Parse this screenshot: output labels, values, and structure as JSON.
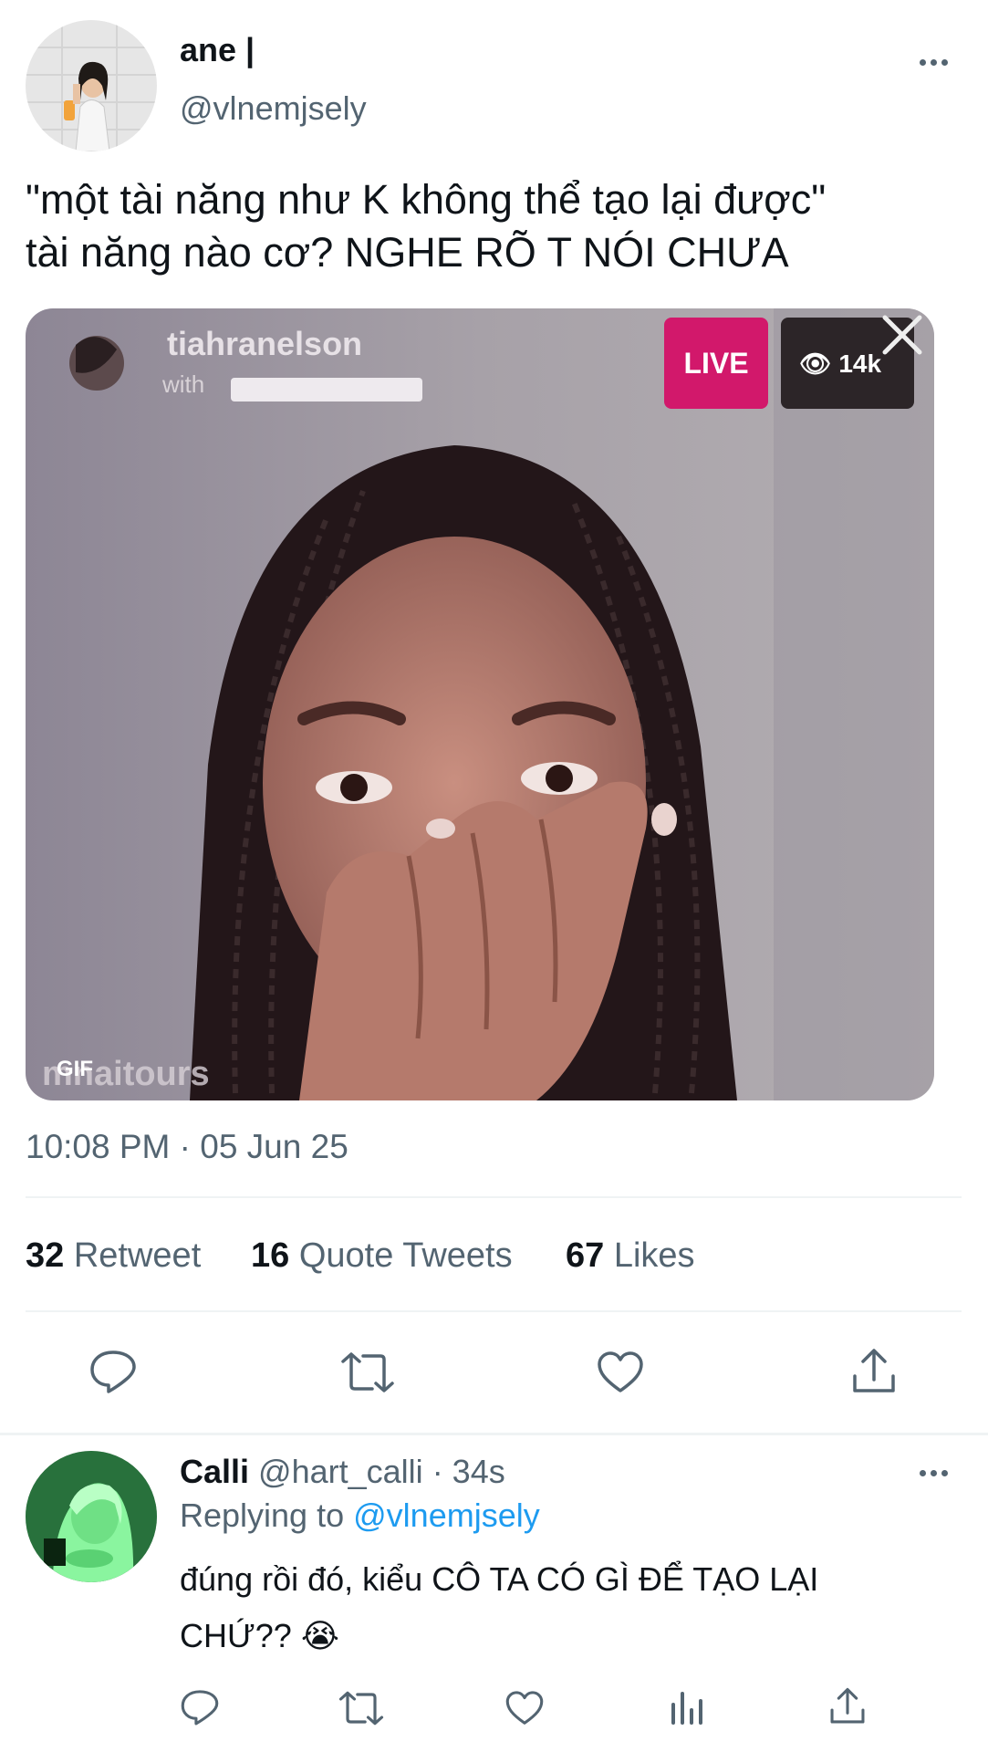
{
  "tweet": {
    "author_name": "ane |",
    "author_handle": "@vlnemjsely",
    "text_line1": "\"một tài năng như K không thể tạo lại được\"",
    "text_line2": "tài năng nào cơ? NGHE RÕ T NÓI CHƯA",
    "media": {
      "overlay_username": "tiahranelson",
      "overlay_with": "with",
      "live_label": "LIVE",
      "viewer_count": "14k",
      "gif_badge": "GIF",
      "watermark": "mnaitours"
    },
    "timestamp": "10:08 PM · 05 Jun 25",
    "stats": {
      "retweets_count": "32",
      "retweets_label": "Retweet",
      "quotes_count": "16",
      "quotes_label": "Quote Tweets",
      "likes_count": "67",
      "likes_label": "Likes"
    },
    "actions": [
      "reply-icon",
      "retweet-icon",
      "like-icon",
      "share-icon"
    ]
  },
  "reply": {
    "author_name": "Calli",
    "author_handle": "@hart_calli",
    "time": "· 34s",
    "replying_prefix": "Replying to",
    "replying_to": "@vlnemjsely",
    "text_line1": "đúng rồi đó, kiểu CÔ TA CÓ GÌ ĐỂ TẠO LẠI",
    "text_line2": "CHỨ??",
    "emoji": "😭",
    "actions": [
      "reply-icon",
      "retweet-icon",
      "like-icon",
      "analytics-icon",
      "share-icon"
    ]
  },
  "colors": {
    "text": "#0f1419",
    "secondary": "#536471",
    "accent": "#1d9bf0",
    "live_badge": "#d2186b",
    "divider": "#eff3f4"
  }
}
